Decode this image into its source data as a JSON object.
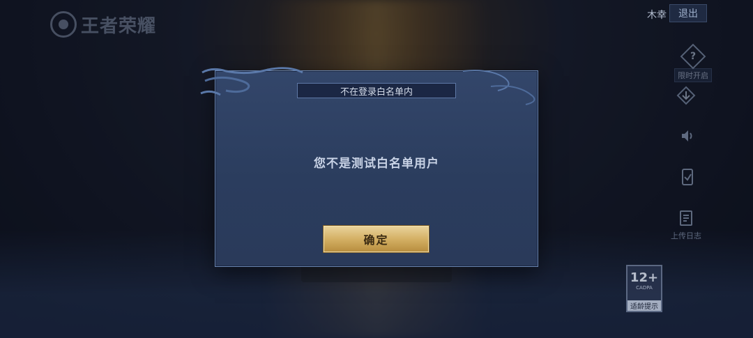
{
  "header": {
    "logo_text": "王者荣耀",
    "user_name": "木幸",
    "logout_label": "退出"
  },
  "side_menu": {
    "limited_label": "限时开启",
    "upload_log_label": "上传日志"
  },
  "age_rating": {
    "number": "12+",
    "org": "CADPA",
    "tip": "适龄提示"
  },
  "dialog": {
    "title": "不在登录白名单内",
    "message": "您不是测试白名单用户",
    "confirm_label": "确定"
  },
  "icons": [
    "help-icon",
    "download-icon",
    "volume-icon",
    "repair-icon",
    "log-icon"
  ],
  "colors": {
    "accent_gold": "#d4b064",
    "dialog_bg": "#2b3d5e",
    "dialog_border": "#6a86b2"
  }
}
